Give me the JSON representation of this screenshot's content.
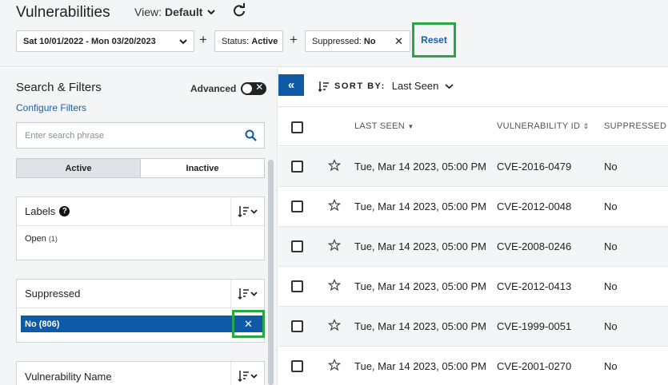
{
  "header": {
    "title": "Vulnerabilities",
    "view_label": "View:",
    "view_value": "Default",
    "filters": {
      "date_range": "Sat 10/01/2022 - Mon 03/20/2023",
      "status_label": "Status:",
      "status_value": "Active",
      "suppressed_label": "Suppressed:",
      "suppressed_value": "No",
      "reset_label": "Reset"
    }
  },
  "sidebar": {
    "title": "Search & Filters",
    "advanced_label": "Advanced",
    "configure_filters": "Configure Filters",
    "search_placeholder": "Enter search phrase",
    "segments": [
      "Active",
      "Inactive"
    ],
    "labels_panel": {
      "title": "Labels",
      "option": "Open",
      "option_count": "(1)"
    },
    "suppressed_panel": {
      "title": "Suppressed",
      "selected": "No (806)"
    },
    "vuln_name_panel": {
      "title": "Vulnerability Name"
    }
  },
  "main": {
    "sort_by_label": "SORT BY:",
    "sort_by_value": "Last Seen",
    "columns": {
      "last_seen": "LAST SEEN",
      "vuln_id": "VULNERABILITY ID",
      "suppressed": "SUPPRESSED"
    },
    "rows": [
      {
        "last_seen": "Tue, Mar 14 2023, 05:00 PM",
        "vuln_id": "CVE-2016-0479",
        "suppressed": "No"
      },
      {
        "last_seen": "Tue, Mar 14 2023, 05:00 PM",
        "vuln_id": "CVE-2012-0048",
        "suppressed": "No"
      },
      {
        "last_seen": "Tue, Mar 14 2023, 05:00 PM",
        "vuln_id": "CVE-2008-0246",
        "suppressed": "No"
      },
      {
        "last_seen": "Tue, Mar 14 2023, 05:00 PM",
        "vuln_id": "CVE-2012-0413",
        "suppressed": "No"
      },
      {
        "last_seen": "Tue, Mar 14 2023, 05:00 PM",
        "vuln_id": "CVE-1999-0051",
        "suppressed": "No"
      },
      {
        "last_seen": "Tue, Mar 14 2023, 05:00 PM",
        "vuln_id": "CVE-2001-0270",
        "suppressed": "No"
      }
    ]
  },
  "colors": {
    "accent": "#0e5aa7",
    "highlight": "#27a844",
    "link": "#1f5ea8"
  }
}
